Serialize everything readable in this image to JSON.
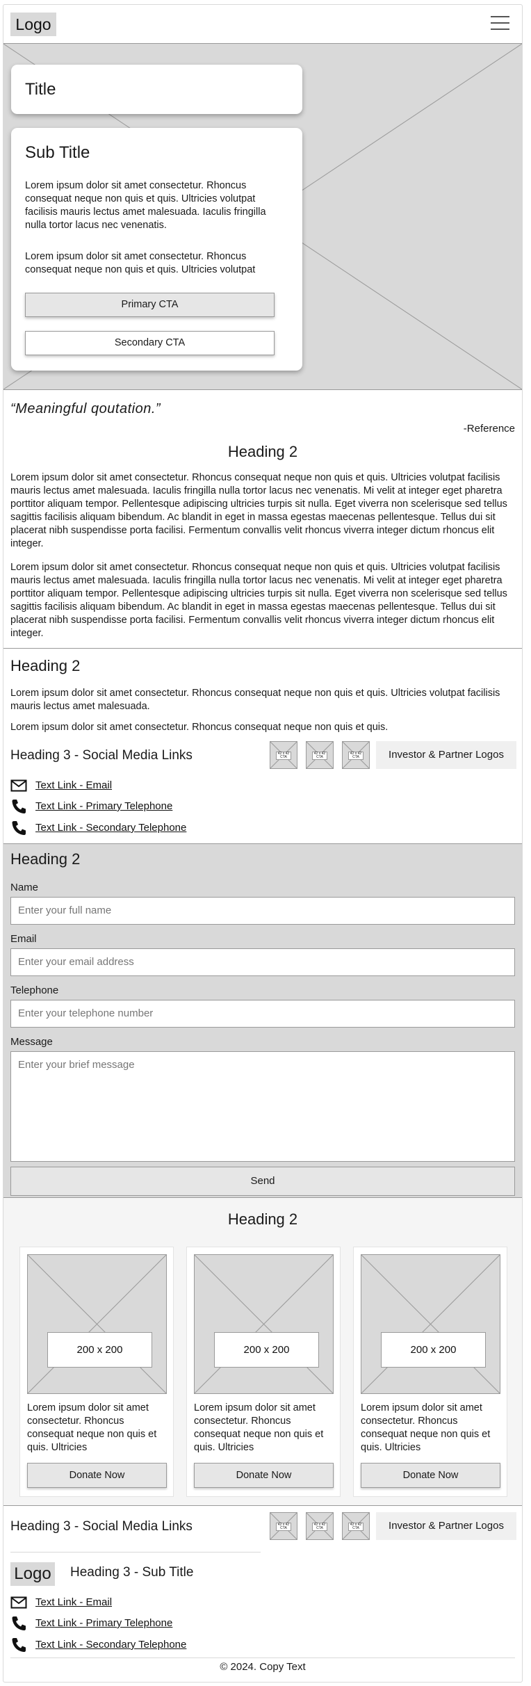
{
  "header": {
    "logo": "Logo",
    "menu_icon": "hamburger-menu-icon"
  },
  "hero": {
    "title": "Title",
    "subtitle": "Sub Title",
    "paragraph1": "Lorem ipsum dolor sit amet consectetur. Rhoncus consequat neque non quis et quis. Ultricies volutpat facilisis mauris lectus amet malesuada. Iaculis fringilla nulla tortor lacus nec venenatis.",
    "paragraph2": "Lorem ipsum dolor sit amet consectetur. Rhoncus consequat neque non quis et quis. Ultricies volutpat",
    "primary_cta": "Primary CTA",
    "secondary_cta": "Secondary CTA"
  },
  "quote": {
    "text": "“Meaningful qoutation.”",
    "reference": "-Reference"
  },
  "about": {
    "heading": "Heading 2",
    "paragraph1": "Lorem ipsum dolor sit amet consectetur. Rhoncus consequat neque non quis et quis. Ultricies volutpat facilisis mauris lectus amet malesuada. Iaculis fringilla nulla tortor lacus nec venenatis. Mi velit at integer eget pharetra porttitor aliquam tempor. Pellentesque adipiscing ultricies turpis sit nulla. Eget viverra non scelerisque sed tellus sagittis facilisis aliquam bibendum. Ac blandit in eget in massa egestas maecenas pellentesque. Tellus dui sit placerat nibh suspendisse porta facilisi. Fermentum convallis velit rhoncus viverra integer dictum rhoncus elit integer.",
    "paragraph2": "Lorem ipsum dolor sit amet consectetur. Rhoncus consequat neque non quis et quis. Ultricies volutpat facilisis mauris lectus amet malesuada. Iaculis fringilla nulla tortor lacus nec venenatis. Mi velit at integer eget pharetra porttitor aliquam tempor. Pellentesque adipiscing ultricies turpis sit nulla. Eget viverra non scelerisque sed tellus sagittis facilisis aliquam bibendum. Ac blandit in eget in massa egestas maecenas pellentesque. Tellus dui sit placerat nibh suspendisse porta facilisi. Fermentum convallis velit rhoncus viverra integer dictum rhoncus elit integer."
  },
  "contact": {
    "heading": "Heading 2",
    "paragraph1": "Lorem ipsum dolor sit amet consectetur. Rhoncus consequat neque non quis et quis. Ultricies volutpat facilisis mauris lectus amet malesuada.",
    "paragraph2": "Lorem ipsum dolor sit amet consectetur. Rhoncus consequat neque non quis et quis.",
    "social_heading": "Heading 3 - Social Media Links",
    "logo_label": "42 x 42 CTA",
    "partner_label": "Investor & Partner Logos",
    "email_link": "Text Link - Email",
    "phone_primary_link": "Text Link - Primary Telephone",
    "phone_secondary_link": "Text Link - Secondary Telephone"
  },
  "form": {
    "heading": "Heading 2",
    "name_label": "Name",
    "name_placeholder": "Enter your full name",
    "email_label": "Email",
    "email_placeholder": "Enter your email address",
    "phone_label": "Telephone",
    "phone_placeholder": "Enter your telephone number",
    "message_label": "Message",
    "message_placeholder": "Enter your brief message",
    "send_label": "Send"
  },
  "donations": {
    "heading": "Heading 2",
    "cards": [
      {
        "image_label": "200 x 200",
        "text": "Lorem ipsum dolor sit amet consectetur. Rhoncus consequat neque non quis et quis. Ultricies",
        "button": "Donate Now"
      },
      {
        "image_label": "200 x 200",
        "text": "Lorem ipsum dolor sit amet consectetur. Rhoncus consequat neque non quis et quis. Ultricies",
        "button": "Donate Now"
      },
      {
        "image_label": "200 x 200",
        "text": "Lorem ipsum dolor sit amet consectetur. Rhoncus consequat neque non quis et quis. Ultricies",
        "button": "Donate Now"
      }
    ]
  },
  "footer": {
    "social_heading": "Heading 3 - Social Media Links",
    "logo_label": "42 x 42 CTA",
    "partner_label": "Investor & Partner Logos",
    "logo": "Logo",
    "subtitle": "Heading 3 - Sub Title",
    "email_link": "Text Link - Email",
    "phone_primary_link": "Text Link - Primary Telephone",
    "phone_secondary_link": "Text Link - Secondary Telephone",
    "copyright": "© 2024. Copy Text"
  },
  "colors": {
    "placeholder_gray": "#d9d9d9",
    "border_gray": "#9a9a9a",
    "button_gray": "#e6e6e6"
  }
}
